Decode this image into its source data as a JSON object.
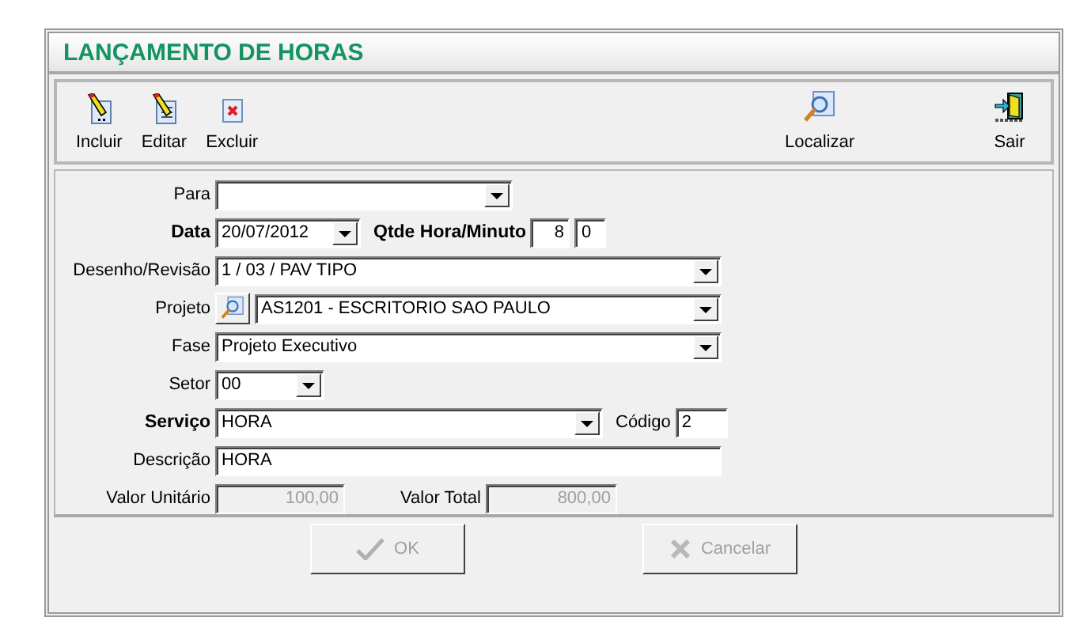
{
  "window": {
    "title": "LANÇAMENTO DE HORAS"
  },
  "toolbar": {
    "left": [
      {
        "label": "Incluir",
        "kind": "new"
      },
      {
        "label": "Editar",
        "kind": "edit"
      },
      {
        "label": "Excluir",
        "kind": "delete"
      }
    ],
    "right": [
      {
        "label": "Localizar",
        "kind": "find"
      },
      {
        "label": "Sair",
        "kind": "exit"
      }
    ]
  },
  "form": {
    "para": {
      "label": "Para",
      "bold": false
    },
    "data": {
      "label": "Data",
      "bold": true,
      "value": "20/07/2012"
    },
    "qtde": {
      "label": "Qtde Hora/Minuto",
      "bold": true,
      "hours": "8",
      "minutes": "0"
    },
    "desenho": {
      "label": "Desenho/Revisão",
      "bold": false,
      "value": "1 / 03 / PAV  TIPO"
    },
    "projeto": {
      "label": "Projeto",
      "bold": false,
      "value": "AS1201 - ESCRITORIO SAO PAULO"
    },
    "fase": {
      "label": "Fase",
      "bold": false,
      "value": "Projeto Executivo"
    },
    "setor": {
      "label": "Setor",
      "bold": false,
      "value": "00"
    },
    "servico": {
      "label": "Serviço",
      "bold": true,
      "value": "HORA"
    },
    "codigo": {
      "label": "Código",
      "bold": false,
      "value": "2"
    },
    "descricao": {
      "label": "Descrição",
      "bold": false,
      "value": "HORA"
    },
    "valor_unitario": {
      "label": "Valor Unitário",
      "bold": false,
      "value": "100,00",
      "disabled": true
    },
    "valor_total": {
      "label": "Valor Total",
      "bold": false,
      "value": "800,00",
      "disabled": true
    }
  },
  "buttons": [
    {
      "label": "OK",
      "kind": "ok",
      "disabled": true
    },
    {
      "label": "Cancelar",
      "kind": "cancel",
      "disabled": true
    }
  ]
}
